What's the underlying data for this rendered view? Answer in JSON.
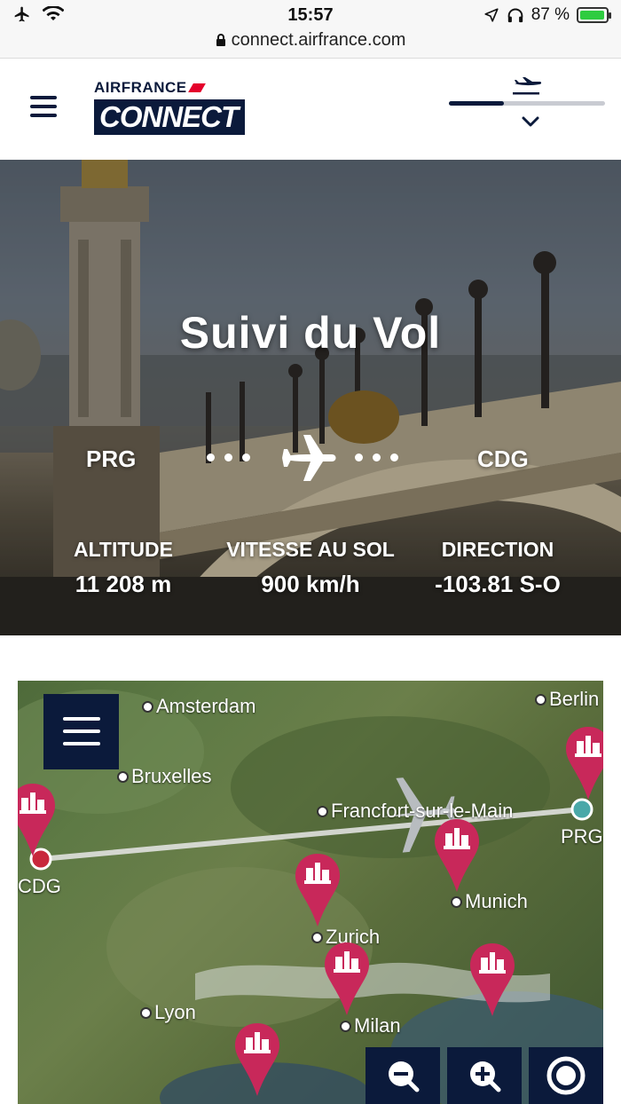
{
  "status_bar": {
    "time": "15:57",
    "battery_percent": "87 %",
    "url": "connect.airfrance.com"
  },
  "header": {
    "logo_top": "AIRFRANCE",
    "logo_bottom": "CONNECT",
    "flight_progress": 0.35
  },
  "hero": {
    "title": "Suivi du Vol",
    "origin": "PRG",
    "destination": "CDG",
    "stats": [
      {
        "label": "ALTITUDE",
        "value": "11 208 m"
      },
      {
        "label": "VITESSE AU SOL",
        "value": "900 km/h"
      },
      {
        "label": "DIRECTION",
        "value": "-103.81 S-O"
      }
    ]
  },
  "map": {
    "cities": [
      {
        "name": "Amsterdam"
      },
      {
        "name": "Berlin"
      },
      {
        "name": "Bruxelles"
      },
      {
        "name": "Francfort-sur-le-Main"
      },
      {
        "name": "Munich"
      },
      {
        "name": "Zurich"
      },
      {
        "name": "Lyon"
      },
      {
        "name": "Milan"
      }
    ],
    "airports": {
      "origin": "PRG",
      "destination": "CDG"
    },
    "colors": {
      "route": "#e8e8e8",
      "pin": "#c8285a",
      "origin_marker": "#4aa8a8",
      "destination_marker": "#c8283c"
    }
  },
  "icons": [
    "airplane-icon",
    "wifi-icon",
    "location-icon",
    "headphones-icon",
    "battery-icon",
    "lock-icon",
    "hamburger-icon",
    "landing-icon",
    "chevron-down-icon",
    "zoom-out-icon",
    "zoom-in-icon",
    "recenter-icon",
    "poi-pin-icon"
  ]
}
